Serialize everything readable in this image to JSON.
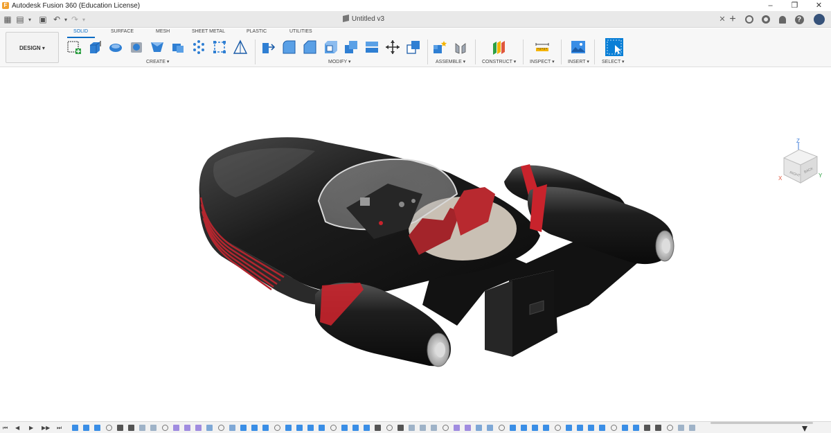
{
  "window": {
    "title": "Autodesk Fusion 360 (Education License)",
    "controls": [
      "–",
      "❐",
      "✕"
    ]
  },
  "document": {
    "tab_title": "Untitled v3",
    "close": "✕"
  },
  "quick_access": {
    "grid": "▦",
    "file": "▤",
    "save": "▣",
    "undo": "↶",
    "redo": "↷",
    "caret": "▾"
  },
  "workspace": {
    "label": "DESIGN ▾"
  },
  "ribbon_tabs": [
    "SOLID",
    "SURFACE",
    "MESH",
    "SHEET METAL",
    "PLASTIC",
    "UTILITIES"
  ],
  "groups": {
    "create": "CREATE ▾",
    "modify": "MODIFY ▾",
    "assemble": "ASSEMBLE ▾",
    "construct": "CONSTRUCT ▾",
    "inspect": "INSPECT ▾",
    "insert": "INSERT ▾",
    "select": "SELECT ▾"
  },
  "viewcube": {
    "axis_z": "Z",
    "axis_x": "X",
    "axis_y": "Y",
    "face_right": "RIGHT",
    "face_back": "BACK"
  },
  "timeline": {
    "controls": [
      "⏮",
      "◀",
      "▶",
      "▶▶",
      "⏭"
    ]
  },
  "colors": {
    "accent": "#0a6cc4",
    "body_dark": "#1c1c1c",
    "stripe_red": "#c8232c",
    "seat_floor": "#c9c0b4"
  }
}
